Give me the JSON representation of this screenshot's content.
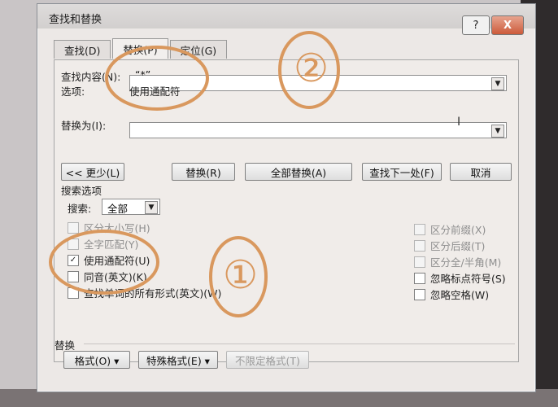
{
  "window": {
    "title": "查找和替换",
    "help_label": "?",
    "close_label": "X"
  },
  "tabs": [
    {
      "label": "查找(D)"
    },
    {
      "label": "替换(P)"
    },
    {
      "label": "定位(G)"
    }
  ],
  "find": {
    "label": "查找内容(N):",
    "value": "“*”",
    "options_label": "选项:",
    "options_value": "使用通配符"
  },
  "replace": {
    "label": "替换为(I):",
    "value": ""
  },
  "buttons": {
    "less": "<< 更少(L)",
    "replace": "替换(R)",
    "replace_all": "全部替换(A)",
    "find_next": "查找下一处(F)",
    "cancel": "取消"
  },
  "search_options": {
    "section_label": "搜索选项",
    "search_label": "搜索:",
    "search_value": "全部",
    "left_checks": [
      {
        "label": "区分大小写(H)",
        "checked": false,
        "enabled": false
      },
      {
        "label": "全字匹配(Y)",
        "checked": false,
        "enabled": false
      },
      {
        "label": "使用通配符(U)",
        "checked": true,
        "enabled": true
      },
      {
        "label": "同音(英文)(K)",
        "checked": false,
        "enabled": true
      },
      {
        "label": "查找单词的所有形式(英文)(W)",
        "checked": false,
        "enabled": true
      }
    ],
    "right_checks": [
      {
        "label": "区分前缀(X)",
        "checked": false,
        "enabled": false
      },
      {
        "label": "区分后缀(T)",
        "checked": false,
        "enabled": false
      },
      {
        "label": "区分全/半角(M)",
        "checked": false,
        "enabled": false
      },
      {
        "label": "忽略标点符号(S)",
        "checked": false,
        "enabled": true
      },
      {
        "label": "忽略空格(W)",
        "checked": false,
        "enabled": true
      }
    ]
  },
  "replace_section": {
    "label": "替换",
    "format_button": "格式(O) ▾",
    "special_button": "特殊格式(E) ▾",
    "no_format_button": "不限定格式(T)"
  },
  "annotations": {
    "circle1": "①",
    "circle2": "②",
    "color": "#d9985e"
  }
}
